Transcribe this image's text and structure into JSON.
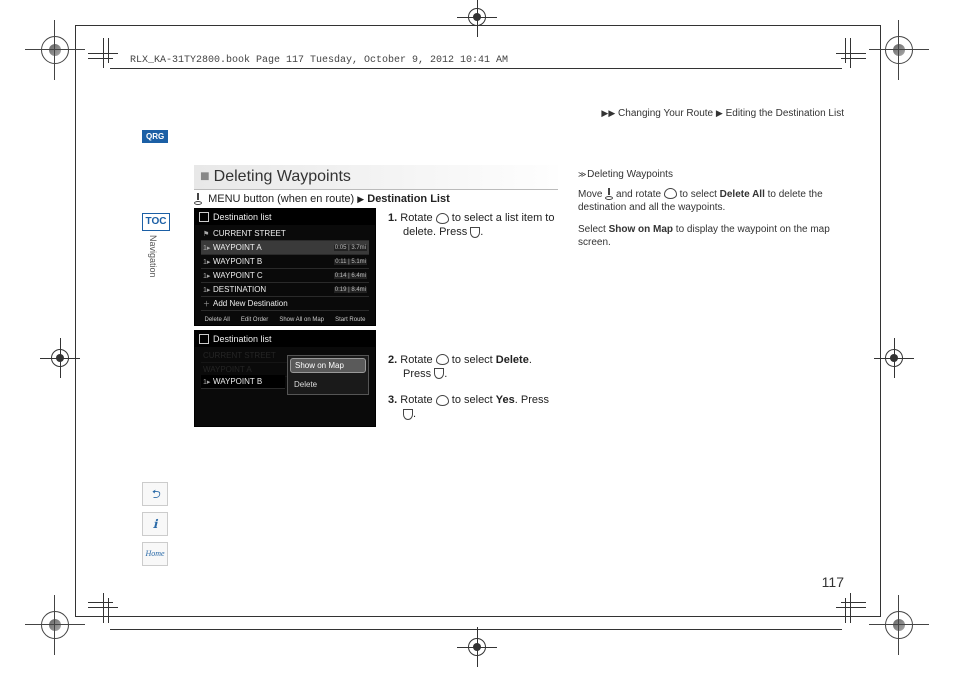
{
  "meta_header": "RLX_KA-31TY2800.book  Page 117  Tuesday, October 9, 2012  10:41 AM",
  "breadcrumb": {
    "arrows": "▶▶",
    "part1": "Changing Your Route",
    "sep": "▶",
    "part2": "Editing the Destination List"
  },
  "qrg": "QRG",
  "toc": "TOC",
  "side_label": "Navigation",
  "section_title": "Deleting Waypoints",
  "menu_line": {
    "pre": "MENU button (when en route)",
    "sep": "▶",
    "dest": "Destination List"
  },
  "shot1": {
    "title": "Destination list",
    "rows": [
      {
        "flag": "⚑",
        "label": "CURRENT STREET",
        "dist": ""
      },
      {
        "flag": "1▸",
        "label": "WAYPOINT A",
        "dist": "0:05 | 3.7mi"
      },
      {
        "flag": "1▸",
        "label": "WAYPOINT B",
        "dist": "0:11 | 5.1mi"
      },
      {
        "flag": "1▸",
        "label": "WAYPOINT C",
        "dist": "0:14 | 6.4mi"
      },
      {
        "flag": "1▸",
        "label": "DESTINATION",
        "dist": "0:19 | 8.4mi"
      },
      {
        "flag": "＋",
        "label": "Add New Destination",
        "dist": ""
      }
    ],
    "footer": [
      "Delete All",
      "Edit Order",
      "Show All on Map",
      "Start Route"
    ]
  },
  "shot2": {
    "title": "Destination list",
    "row_label": "WAYPOINT B",
    "popup": {
      "show": "Show on Map",
      "delete": "Delete"
    }
  },
  "steps": {
    "s1": {
      "num": "1.",
      "a": "Rotate ",
      "b": " to select a list item to delete. Press ",
      "c": "."
    },
    "s2": {
      "num": "2.",
      "a": "Rotate ",
      "b": " to select ",
      "bold": "Delete",
      "c": ". Press ",
      "d": "."
    },
    "s3": {
      "num": "3.",
      "a": "Rotate ",
      "b": " to select ",
      "bold": "Yes",
      "c": ". Press ",
      "d": "."
    }
  },
  "notes": {
    "heading": "Deleting Waypoints",
    "p1a": "Move ",
    "p1b": " and rotate ",
    "p1c": " to select ",
    "p1bold": "Delete All",
    "p1d": " to delete the destination and all the waypoints.",
    "p2a": "Select ",
    "p2bold": "Show on Map",
    "p2b": " to display the waypoint on the map screen."
  },
  "left_icons": {
    "voice": "⮌",
    "info": "ℹ",
    "home": "Home"
  },
  "page_number": "117"
}
